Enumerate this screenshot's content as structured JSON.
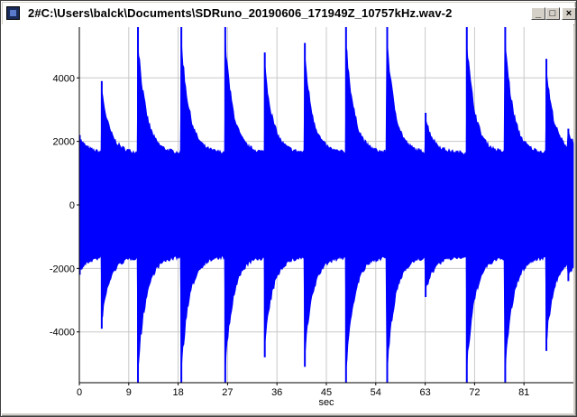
{
  "window": {
    "title": "2#C:\\Users\\balck\\Documents\\SDRuno_20190606_171949Z_10757kHz.wav-2",
    "buttons": {
      "minimize": "_",
      "maximize": "□",
      "close": "×"
    }
  },
  "chart_data": {
    "type": "area",
    "title": "",
    "xlabel": "sec",
    "ylabel": "",
    "xlim": [
      0,
      90
    ],
    "ylim": [
      -5600,
      5600
    ],
    "x_ticks": [
      0,
      9,
      18,
      27,
      36,
      45,
      54,
      63,
      72,
      81
    ],
    "y_ticks": [
      -4000,
      -2000,
      0,
      2000,
      4000
    ],
    "x_tick_labels": [
      "0",
      "9",
      "18",
      "27",
      "36",
      "45",
      "54",
      "63",
      "72",
      "81"
    ],
    "y_tick_labels": [
      "-4000",
      "-2000",
      "0",
      "2000",
      "4000"
    ],
    "grid": true,
    "series_color": "#0000ff",
    "baseline_amplitude": 1700,
    "pulses": [
      {
        "t": 0.0,
        "peak": 2200
      },
      {
        "t": 4.0,
        "peak": 3900
      },
      {
        "t": 10.6,
        "peak": 5600
      },
      {
        "t": 18.5,
        "peak": 5600
      },
      {
        "t": 26.5,
        "peak": 5600
      },
      {
        "t": 33.7,
        "peak": 4800
      },
      {
        "t": 41.0,
        "peak": 5100
      },
      {
        "t": 48.5,
        "peak": 5600
      },
      {
        "t": 56.0,
        "peak": 5600
      },
      {
        "t": 63.0,
        "peak": 2900
      },
      {
        "t": 70.5,
        "peak": 5600
      },
      {
        "t": 77.5,
        "peak": 5600
      },
      {
        "t": 85.0,
        "peak": 4600
      },
      {
        "t": 89.0,
        "peak": 2400
      }
    ]
  }
}
